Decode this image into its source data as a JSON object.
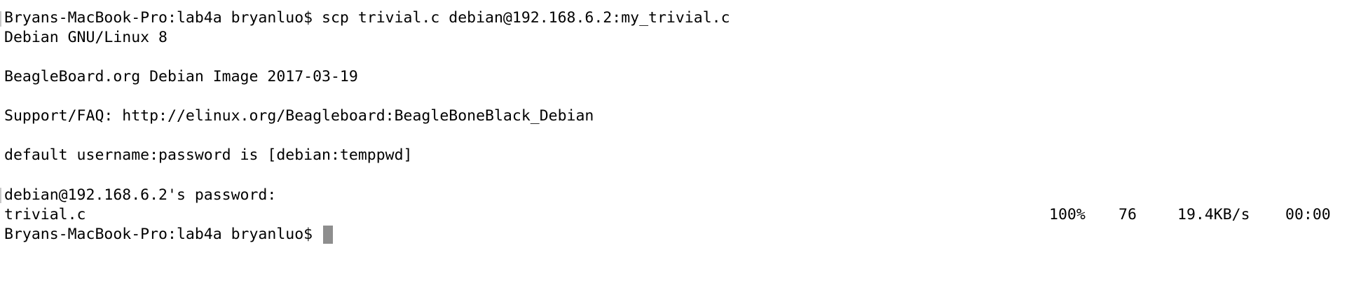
{
  "terminal": {
    "lines": {
      "cmd": "Bryans-MacBook-Pro:lab4a bryanluo$ scp trivial.c debian@192.168.6.2:my_trivial.c",
      "os": "Debian GNU/Linux 8",
      "image": "BeagleBoard.org Debian Image 2017-03-19",
      "support": "Support/FAQ: http://elinux.org/Beagleboard:BeagleBoneBlack_Debian",
      "creds": "default username:password is [debian:temppwd]",
      "password": "debian@192.168.6.2's password:"
    },
    "transfer": {
      "file": "trivial.c",
      "percent": "100%",
      "size": "76",
      "rate": "19.4KB/s",
      "time": "00:00"
    },
    "prompt": "Bryans-MacBook-Pro:lab4a bryanluo$ "
  }
}
